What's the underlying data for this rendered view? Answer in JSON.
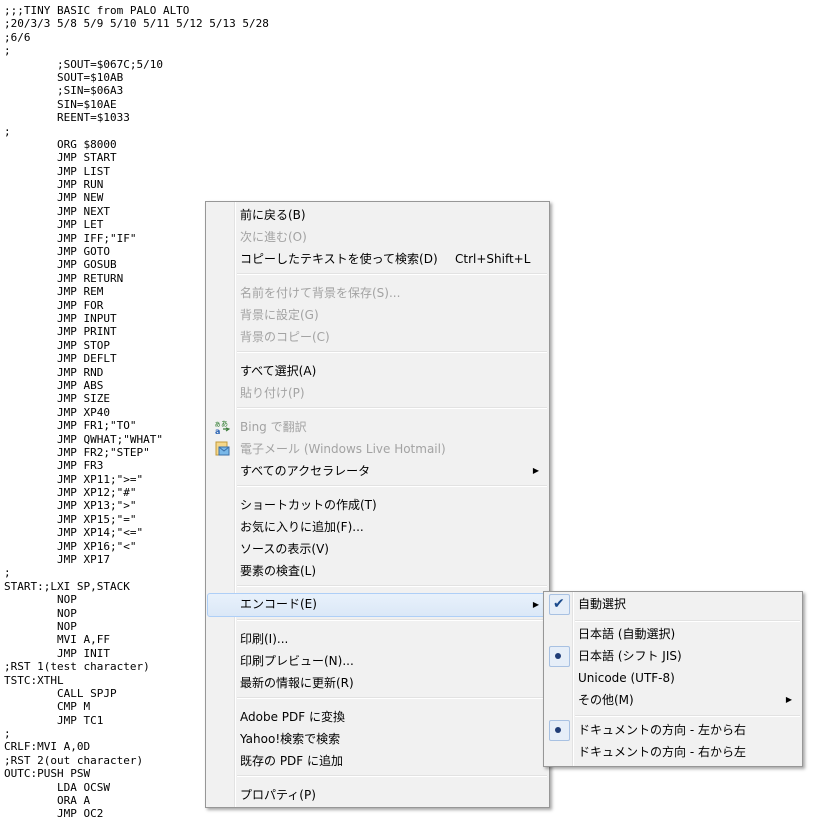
{
  "code_lines": [
    ";;;TINY BASIC from PALO ALTO",
    ";20/3/3 5/8 5/9 5/10 5/11 5/12 5/13 5/28",
    ";6/6",
    ";",
    "        ;SOUT=$067C;5/10",
    "        SOUT=$10AB",
    "        ;SIN=$06A3",
    "        SIN=$10AE",
    "        REENT=$1033",
    ";",
    "        ORG $8000",
    "        JMP START",
    "        JMP LIST",
    "        JMP RUN",
    "        JMP NEW",
    "        JMP NEXT",
    "        JMP LET",
    "        JMP IFF;\"IF\"",
    "        JMP GOTO",
    "        JMP GOSUB",
    "        JMP RETURN",
    "        JMP REM",
    "        JMP FOR",
    "        JMP INPUT",
    "        JMP PRINT",
    "        JMP STOP",
    "        JMP DEFLT",
    "        JMP RND",
    "        JMP ABS",
    "        JMP SIZE",
    "        JMP XP40",
    "        JMP FR1;\"TO\"",
    "        JMP QWHAT;\"WHAT\"",
    "        JMP FR2;\"STEP\"",
    "        JMP FR3",
    "        JMP XP11;\">=\"",
    "        JMP XP12;\"#\"",
    "        JMP XP13;\">\"",
    "        JMP XP15;\"=\"",
    "        JMP XP14;\"<=\"",
    "        JMP XP16;\"<\"",
    "        JMP XP17",
    ";",
    "START:;LXI SP,STACK",
    "        NOP",
    "        NOP",
    "        NOP",
    "        MVI A,FF",
    "        JMP INIT",
    ";RST 1(test character)",
    "TSTC:XTHL",
    "        CALL SPJP",
    "        CMP M",
    "        JMP TC1",
    ";",
    "CRLF:MVI A,0D",
    ";RST 2(out character)",
    "OUTC:PUSH PSW",
    "        LDA OCSW",
    "        ORA A",
    "        JMP OC2"
  ],
  "context_menu": {
    "back": "前に戻る(B)",
    "forward": "次に進む(O)",
    "search_copied": "コピーしたテキストを使って検索(D)",
    "search_copied_shortcut": "Ctrl+Shift+L",
    "save_background": "名前を付けて背景を保存(S)...",
    "set_background": "背景に設定(G)",
    "copy_background": "背景のコピー(C)",
    "select_all": "すべて選択(A)",
    "paste": "貼り付け(P)",
    "bing_translate": "Bing で翻訳",
    "email": "電子メール (Windows Live Hotmail)",
    "all_accelerators": "すべてのアクセラレータ",
    "create_shortcut": "ショートカットの作成(T)",
    "add_favorites": "お気に入りに追加(F)...",
    "view_source": "ソースの表示(V)",
    "inspect_element": "要素の検査(L)",
    "encoding": "エンコード(E)",
    "print": "印刷(I)...",
    "print_preview": "印刷プレビュー(N)...",
    "refresh": "最新の情報に更新(R)",
    "adobe_pdf": "Adobe PDF に変換",
    "yahoo_search": "Yahoo!検索で検索",
    "add_existing_pdf": "既存の PDF に追加",
    "properties": "プロパティ(P)"
  },
  "encoding_submenu": {
    "auto_select": "自動選択",
    "japanese_auto": "日本語 (自動選択)",
    "japanese_shift_jis": "日本語 (シフト JIS)",
    "unicode_utf8": "Unicode (UTF-8)",
    "other": "その他(M)",
    "direction_ltr": "ドキュメントの方向 - 左から右",
    "direction_rtl": "ドキュメントの方向 - 右から左"
  },
  "icons": {
    "bing_translate": "translate-icon",
    "email": "email-icon",
    "submenu_arrow": "chevron-right-icon",
    "checked": "check-icon",
    "radio_selected": "bullet-icon"
  },
  "colors": {
    "menu_background": "#f1f1f1",
    "menu_border": "#979797",
    "highlight": "#dbe8f7",
    "disabled_text": "#a3a3a3"
  }
}
